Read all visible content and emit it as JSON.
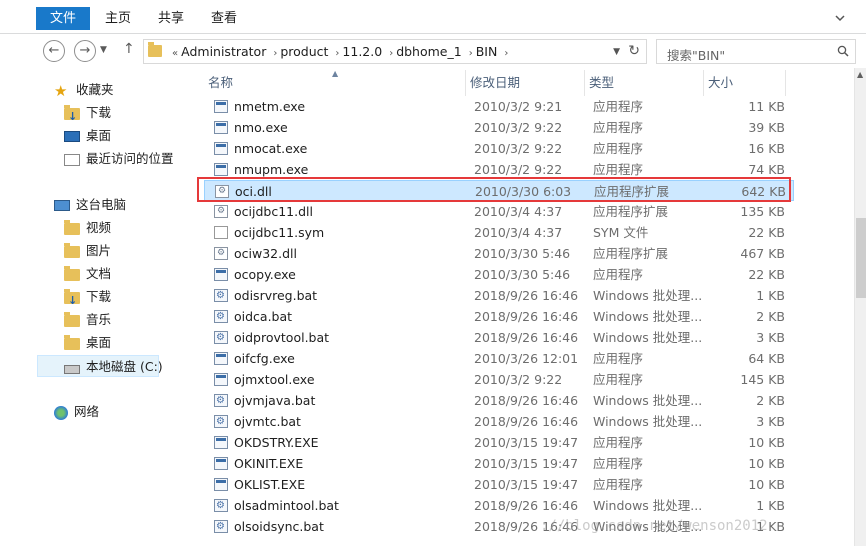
{
  "ribbon": {
    "tabs": [
      "文件",
      "主页",
      "共享",
      "查看"
    ]
  },
  "nav": {
    "breadcrumb_prefix": "«",
    "breadcrumbs": [
      "Administrator",
      "product",
      "11.2.0",
      "dbhome_1",
      "BIN"
    ],
    "search_placeholder": "搜索\"BIN\""
  },
  "sidebar": {
    "favorites": {
      "label": "收藏夹",
      "items": [
        "下载",
        "桌面",
        "最近访问的位置"
      ]
    },
    "this_pc": {
      "label": "这台电脑",
      "items": [
        "视频",
        "图片",
        "文档",
        "下载",
        "音乐",
        "桌面",
        "本地磁盘 (C:)"
      ]
    },
    "network": {
      "label": "网络"
    }
  },
  "columns": {
    "name": "名称",
    "date": "修改日期",
    "type": "类型",
    "size": "大小"
  },
  "files": [
    {
      "name": "nmetm.exe",
      "date": "2010/3/2 9:21",
      "type": "应用程序",
      "size": "11 KB",
      "icon": "exe"
    },
    {
      "name": "nmo.exe",
      "date": "2010/3/2 9:22",
      "type": "应用程序",
      "size": "39 KB",
      "icon": "exe"
    },
    {
      "name": "nmocat.exe",
      "date": "2010/3/2 9:22",
      "type": "应用程序",
      "size": "16 KB",
      "icon": "exe"
    },
    {
      "name": "nmupm.exe",
      "date": "2010/3/2 9:22",
      "type": "应用程序",
      "size": "74 KB",
      "icon": "exe"
    },
    {
      "name": "oci.dll",
      "date": "2010/3/30 6:03",
      "type": "应用程序扩展",
      "size": "642 KB",
      "icon": "dll"
    },
    {
      "name": "ocijdbc11.dll",
      "date": "2010/3/4 4:37",
      "type": "应用程序扩展",
      "size": "135 KB",
      "icon": "dll"
    },
    {
      "name": "ocijdbc11.sym",
      "date": "2010/3/4 4:37",
      "type": "SYM 文件",
      "size": "22 KB",
      "icon": "sym"
    },
    {
      "name": "ociw32.dll",
      "date": "2010/3/30 5:46",
      "type": "应用程序扩展",
      "size": "467 KB",
      "icon": "dll"
    },
    {
      "name": "ocopy.exe",
      "date": "2010/3/30 5:46",
      "type": "应用程序",
      "size": "22 KB",
      "icon": "exe"
    },
    {
      "name": "odisrvreg.bat",
      "date": "2018/9/26 16:46",
      "type": "Windows 批处理...",
      "size": "1 KB",
      "icon": "bat"
    },
    {
      "name": "oidca.bat",
      "date": "2018/9/26 16:46",
      "type": "Windows 批处理...",
      "size": "2 KB",
      "icon": "bat"
    },
    {
      "name": "oidprovtool.bat",
      "date": "2018/9/26 16:46",
      "type": "Windows 批处理...",
      "size": "3 KB",
      "icon": "bat"
    },
    {
      "name": "oifcfg.exe",
      "date": "2010/3/26 12:01",
      "type": "应用程序",
      "size": "64 KB",
      "icon": "exe"
    },
    {
      "name": "ojmxtool.exe",
      "date": "2010/3/2 9:22",
      "type": "应用程序",
      "size": "145 KB",
      "icon": "exe"
    },
    {
      "name": "ojvmjava.bat",
      "date": "2018/9/26 16:46",
      "type": "Windows 批处理...",
      "size": "2 KB",
      "icon": "bat"
    },
    {
      "name": "ojvmtc.bat",
      "date": "2018/9/26 16:46",
      "type": "Windows 批处理...",
      "size": "3 KB",
      "icon": "bat"
    },
    {
      "name": "OKDSTRY.EXE",
      "date": "2010/3/15 19:47",
      "type": "应用程序",
      "size": "10 KB",
      "icon": "exe"
    },
    {
      "name": "OKINIT.EXE",
      "date": "2010/3/15 19:47",
      "type": "应用程序",
      "size": "10 KB",
      "icon": "exe"
    },
    {
      "name": "OKLIST.EXE",
      "date": "2010/3/15 19:47",
      "type": "应用程序",
      "size": "10 KB",
      "icon": "exe"
    },
    {
      "name": "olsadmintool.bat",
      "date": "2018/9/26 16:46",
      "type": "Windows 批处理...",
      "size": "1 KB",
      "icon": "bat"
    },
    {
      "name": "olsoidsync.bat",
      "date": "2018/9/26 16:46",
      "type": "Windows 批处理...",
      "size": "1 KB",
      "icon": "bat"
    }
  ],
  "selected_index": 4,
  "watermark": "://blog.csdn.net/wenson2012"
}
